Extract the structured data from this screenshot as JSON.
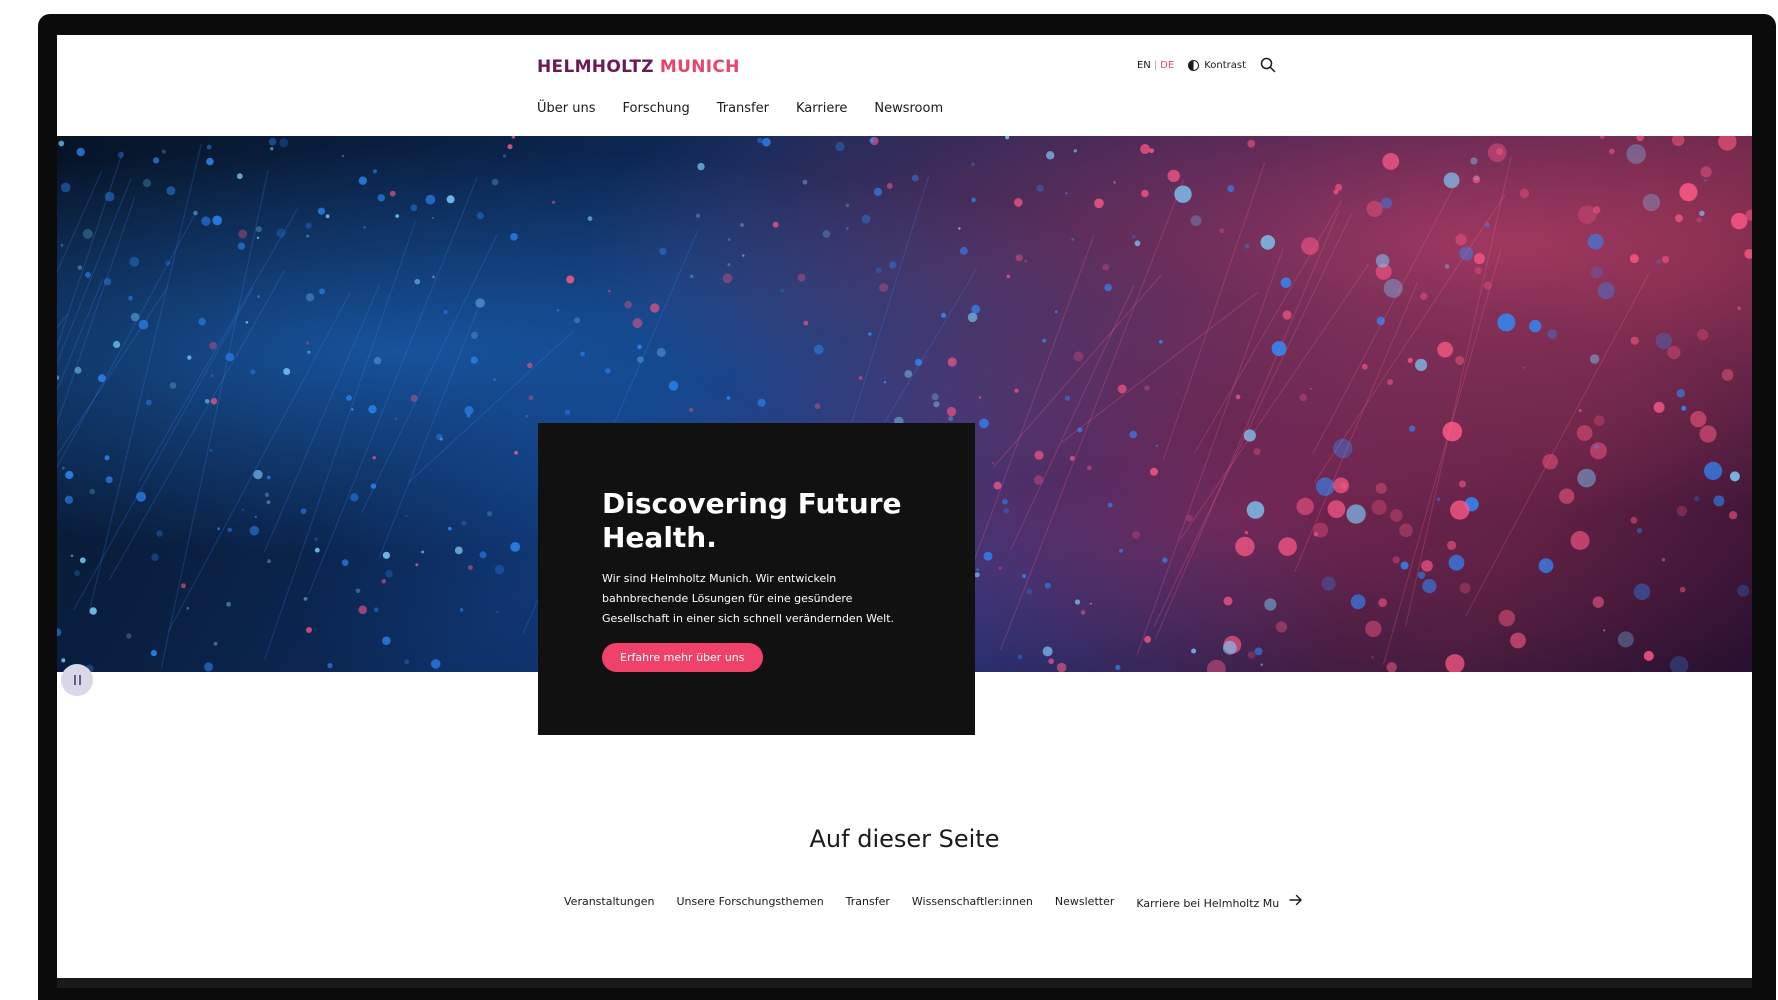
{
  "brand": {
    "word1": "HELMHOLTZ",
    "word2": "MUNICH",
    "color_primary": "#6b1a56",
    "color_accent": "#e8456b"
  },
  "utility": {
    "lang_en": "EN",
    "lang_sep": "|",
    "lang_de": "DE",
    "contrast_label": "Kontrast"
  },
  "nav": {
    "items": [
      "Über uns",
      "Forschung",
      "Transfer",
      "Karriere",
      "Newsroom"
    ]
  },
  "hero": {
    "title": "Discovering Future Health.",
    "text": "Wir sind Helmholtz Munich. Wir entwickeln bahnbrechende Lösungen für eine gesündere Gesellschaft in einer sich schnell verändernden Welt.",
    "cta": "Erfahre mehr über uns"
  },
  "section": {
    "title": "Auf dieser Seite",
    "anchors": [
      "Veranstaltungen",
      "Unsere Forschungsthemen",
      "Transfer",
      "Wissenschaftler:innen",
      "Newsletter",
      "Karriere bei Helmholtz Mu"
    ]
  },
  "icons": {
    "search": "search-icon",
    "contrast": "contrast-icon",
    "pause": "pause-icon",
    "arrow": "arrow-right-icon"
  }
}
